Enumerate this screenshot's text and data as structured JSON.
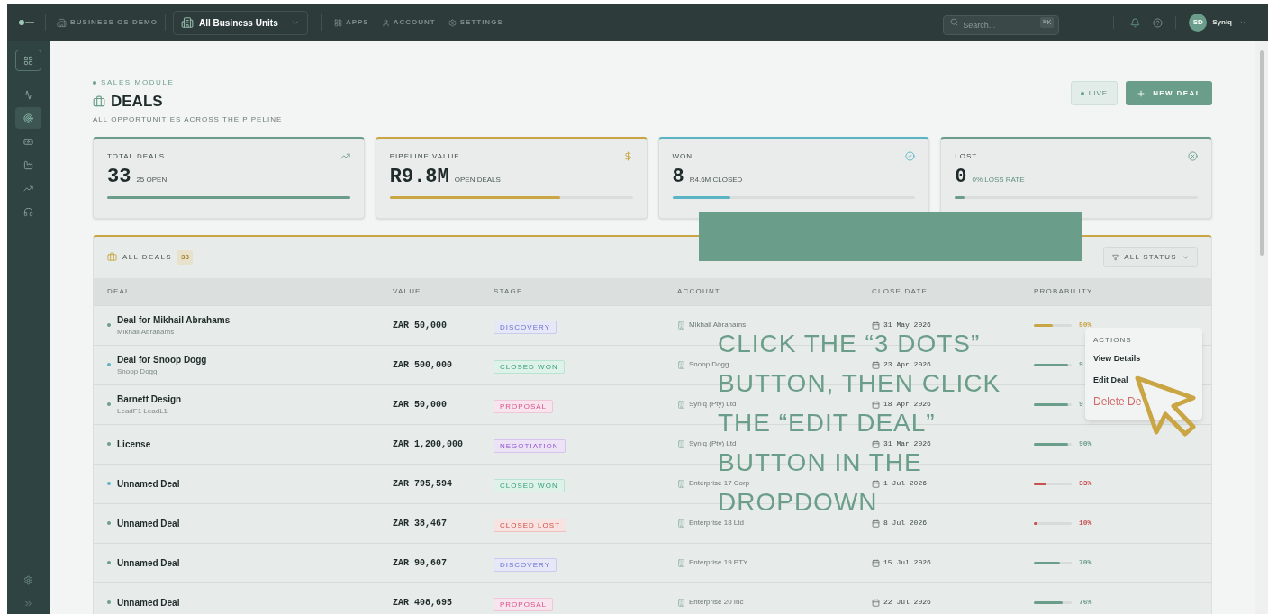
{
  "topbar": {
    "workspace": "BUSINESS OS DEMO",
    "unit_selector": "All Business Units",
    "nav": [
      "APPS",
      "ACCOUNT",
      "SETTINGS"
    ],
    "search": {
      "placeholder": "Search...",
      "shortcut": "⌘K"
    },
    "user": {
      "initials": "SD",
      "name": "Syniq"
    }
  },
  "sidebar": {
    "items": [
      {
        "selected": false
      },
      {
        "selected": false
      },
      {
        "selected": true
      },
      {
        "selected": false
      },
      {
        "selected": false
      },
      {
        "selected": false
      },
      {
        "selected": false
      }
    ]
  },
  "header": {
    "module": "SALES MODULE",
    "title": "DEALS",
    "subtitle": "ALL OPPORTUNITIES ACROSS THE PIPELINE",
    "live": "LIVE",
    "new_button": "NEW DEAL"
  },
  "stats": [
    {
      "label": "TOTAL DEALS",
      "value": "33",
      "sub": "25 OPEN",
      "color": "#6a9e8a",
      "level": 1
    },
    {
      "label": "PIPELINE VALUE",
      "value": "R9.8M",
      "sub": "OPEN DEALS",
      "color": "#c9a544",
      "level": 0.7
    },
    {
      "label": "WON",
      "value": "8",
      "sub": "R4.6M CLOSED",
      "color": "#5ab4c4",
      "level": 0.24
    },
    {
      "label": "LOST",
      "value": "0",
      "sub": "0% LOSS RATE",
      "color": "#6a9e8a",
      "level": 0.04
    }
  ],
  "deals_panel": {
    "title": "ALL DEALS",
    "count": "33",
    "filter": "ALL STATUS"
  },
  "table": {
    "columns": [
      "DEAL",
      "VALUE",
      "STAGE",
      "ACCOUNT",
      "CLOSE DATE",
      "PROBABILITY"
    ],
    "rows": [
      {
        "name": "Deal for Mikhail Abrahams",
        "contact": "Mikhail Abrahams",
        "color": "#6a9e8a",
        "value": "ZAR 50,000",
        "stage": {
          "label": "DISCOVERY",
          "kind": "discovery"
        },
        "account": "Mikhail Abrahams",
        "date": "31 May 2026",
        "probability": {
          "level": 0.5,
          "color": "#c9a544",
          "text": "50%"
        }
      },
      {
        "name": "Deal for Snoop Dogg",
        "contact": "Snoop Dogg",
        "color": "#5ab4c4",
        "value": "ZAR 500,000",
        "stage": {
          "label": "CLOSED WON",
          "kind": "won"
        },
        "account": "Snoop Dogg",
        "date": "23 Apr 2026",
        "probability": {
          "level": 0.9,
          "color": "#6a9e8a",
          "text": "9"
        }
      },
      {
        "name": "Barnett Design",
        "contact": "LeadF1 LeadL1",
        "color": "#6a9e8a",
        "value": "ZAR 50,000",
        "stage": {
          "label": "PROPOSAL",
          "kind": "proposal"
        },
        "account": "Syniq (Pty) Ltd",
        "date": "18 Apr 2026",
        "probability": {
          "level": 0.9,
          "color": "#6a9e8a",
          "text": "9"
        }
      },
      {
        "name": "License",
        "color": "#6a9e8a",
        "value": "ZAR 1,200,000",
        "stage": {
          "label": "NEGOTIATION",
          "kind": "negotiation"
        },
        "account": "Syniq (Pty) Ltd",
        "date": "31 Mar 2026",
        "probability": {
          "level": 0.9,
          "color": "#6a9e8a",
          "text": "90%"
        }
      },
      {
        "name": "Unnamed Deal",
        "color": "#5ab4c4",
        "value": "ZAR 795,594",
        "stage": {
          "label": "CLOSED WON",
          "kind": "won"
        },
        "account": "Enterprise 17 Corp",
        "date": "1 Jul 2026",
        "probability": {
          "level": 0.33,
          "color": "#c8504f",
          "text": "33%"
        }
      },
      {
        "name": "Unnamed Deal",
        "color": "#6a9e8a",
        "value": "ZAR 38,467",
        "stage": {
          "label": "CLOSED LOST",
          "kind": "lost"
        },
        "account": "Enterprise 18 Ltd",
        "date": "8 Jul 2026",
        "probability": {
          "level": 0.1,
          "color": "#c8504f",
          "text": "10%"
        }
      },
      {
        "name": "Unnamed Deal",
        "color": "#6a9e8a",
        "value": "ZAR 90,607",
        "stage": {
          "label": "DISCOVERY",
          "kind": "discovery"
        },
        "account": "Enterprise 19 PTY",
        "date": "15 Jul 2026",
        "probability": {
          "level": 0.7,
          "color": "#6a9e8a",
          "text": "70%"
        }
      },
      {
        "name": "Unnamed Deal",
        "color": "#6a9e8a",
        "value": "ZAR 408,695",
        "stage": {
          "label": "PROPOSAL",
          "kind": "proposal"
        },
        "account": "Enterprise 20 Inc",
        "date": "22 Jul 2026",
        "probability": {
          "level": 0.76,
          "color": "#6a9e8a",
          "text": "76%"
        }
      }
    ]
  },
  "actions_menu": {
    "title": "ACTIONS",
    "items": [
      {
        "label": "View Details",
        "kind": "normal"
      },
      {
        "label": "Edit Deal",
        "kind": "normal"
      },
      {
        "label": "Delete De",
        "kind": "danger"
      }
    ]
  },
  "instruction_lines": [
    "CLICK THE “3 DOTS”",
    "BUTTON, THEN CLICK",
    "THE “EDIT DEAL”",
    "BUTTON IN THE",
    "DROPDOWN"
  ]
}
